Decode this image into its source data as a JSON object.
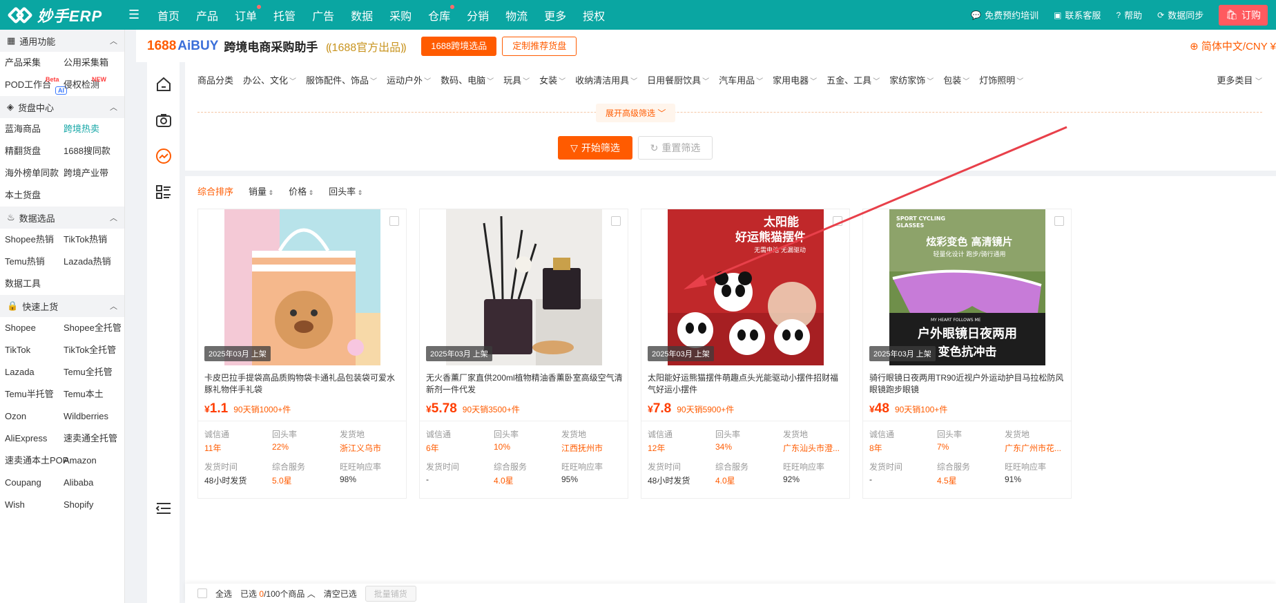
{
  "topbar": {
    "logo_text": "妙手ERP",
    "nav": [
      "首页",
      "产品",
      "订单",
      "托管",
      "广告",
      "数据",
      "采购",
      "仓库",
      "分销",
      "物流",
      "更多",
      "授权"
    ],
    "nav_dots": [
      "订单",
      "仓库"
    ],
    "right": {
      "training": "免费预约培训",
      "support": "联系客服",
      "help": "帮助",
      "sync": "数据同步",
      "order": "订购"
    }
  },
  "sidebar": {
    "sections": [
      {
        "title": "通用功能",
        "icon": "grid-icon",
        "items": [
          "产品采集",
          "公用采集箱",
          "POD工作台",
          "侵权检测"
        ]
      },
      {
        "title": "货盘中心",
        "icon": "cube-icon",
        "items": [
          "蓝海商品",
          "跨境热卖",
          "精翻货盘",
          "1688搜同款",
          "海外榜单同款",
          "跨境产业带",
          "本土货盘"
        ]
      },
      {
        "title": "数据选品",
        "icon": "fire-icon",
        "items": [
          "Shopee热销",
          "TikTok热销",
          "Temu热销",
          "Lazada热销",
          "数据工具"
        ]
      },
      {
        "title": "快速上货",
        "icon": "bag-icon",
        "items": [
          "Shopee",
          "Shopee全托管",
          "TikTok",
          "TikTok全托管",
          "Lazada",
          "Temu全托管",
          "Temu半托管",
          "Temu本土",
          "Ozon",
          "Wildberries",
          "AliExpress",
          "速卖通全托管",
          "速卖通本土POP",
          "Amazon",
          "Coupang",
          "Alibaba",
          "Wish",
          "Shopify"
        ]
      }
    ],
    "active_item": "跨境热卖",
    "badges": {
      "beta": "Beta",
      "new": "NEW",
      "ai": "AI"
    }
  },
  "header": {
    "brand_1688": "1688",
    "brand_aibuy": "AiBUY",
    "title": "跨境电商采购助手",
    "official": "1688官方出品",
    "btn_select": "1688跨境选品",
    "btn_custom": "定制推荐货盘",
    "lang": "简体中文/CNY ¥"
  },
  "filters": {
    "categories": [
      "商品分类",
      "办公、文化",
      "服饰配件、饰品",
      "运动户外",
      "数码、电脑",
      "玩具",
      "女装",
      "收纳清洁用具",
      "日用餐厨饮具",
      "汽车用品",
      "家用电器",
      "五金、工具",
      "家纺家饰",
      "包装",
      "灯饰照明"
    ],
    "more": "更多类目",
    "expand": "展开高级筛选",
    "start": "开始筛选",
    "reset": "重置筛选"
  },
  "sort": {
    "items": [
      "综合排序",
      "销量",
      "价格",
      "回头率"
    ],
    "active": "综合排序"
  },
  "stat_labels": {
    "credit": "诚信通",
    "repeat": "回头率",
    "origin": "发货地",
    "ship_time": "发货时间",
    "service": "综合服务",
    "response": "旺旺响应率"
  },
  "products": [
    {
      "date": "2025年03月 上架",
      "title": "卡皮巴拉手提袋高品质购物袋卡通礼品包装袋可爱水豚礼物伴手礼袋",
      "price": "1.1",
      "sales": "90天销1000+件",
      "credit": "11年",
      "repeat": "22%",
      "origin": "浙江义乌市",
      "ship_time": "48小时发货",
      "service": "5.0星",
      "response": "98%"
    },
    {
      "date": "2025年03月 上架",
      "title": "无火香薰厂家直供200ml植物精油香薰卧室高级空气清新剂一件代发",
      "price": "5.78",
      "sales": "90天销3500+件",
      "credit": "6年",
      "repeat": "10%",
      "origin": "江西抚州市",
      "ship_time": "-",
      "service": "4.0星",
      "response": "95%"
    },
    {
      "date": "2025年03月 上架",
      "title": "太阳能好运熊猫摆件萌趣点头光能驱动小摆件招财福气好运小摆件",
      "price": "7.8",
      "sales": "90天销5900+件",
      "credit": "12年",
      "repeat": "34%",
      "origin": "广东汕头市澄...",
      "ship_time": "48小时发货",
      "service": "4.0星",
      "response": "92%"
    },
    {
      "date": "2025年03月 上架",
      "title": "骑行眼镜日夜两用TR90近视户外运动护目马拉松防风眼镜跑步眼镜",
      "price": "48",
      "sales": "90天销100+件",
      "credit": "8年",
      "repeat": "7%",
      "origin": "广东广州市花...",
      "ship_time": "-",
      "service": "4.5星",
      "response": "91%"
    }
  ],
  "image_text": {
    "panda_l1": "太阳能",
    "panda_l2": "好运熊猫摆件",
    "panda_l3": "无需电池 无漏驱动",
    "glasses_l1": "SPORT CYCLING",
    "glasses_l2": "GLASSES",
    "glasses_l3": "炫彩变色 高清镜片",
    "glasses_l4": "轻量化设计 跑步/骑行通用",
    "glasses_l5": "户外眼镜日夜两用",
    "glasses_l6": "变色抗冲击",
    "glasses_l7": "MY HEART FOLLOWS ME"
  },
  "bottombar": {
    "select_all": "全选",
    "selected_prefix": "已选",
    "selected_count": "0",
    "selected_suffix": "/100个商品",
    "clear": "清空已选",
    "batch": "批量铺货"
  },
  "currency": "¥",
  "colors": {
    "brand": "#0aa6a2",
    "accent": "#ff5b00",
    "price": "#ff3d00",
    "annotation_arrow": "#e8404a"
  }
}
